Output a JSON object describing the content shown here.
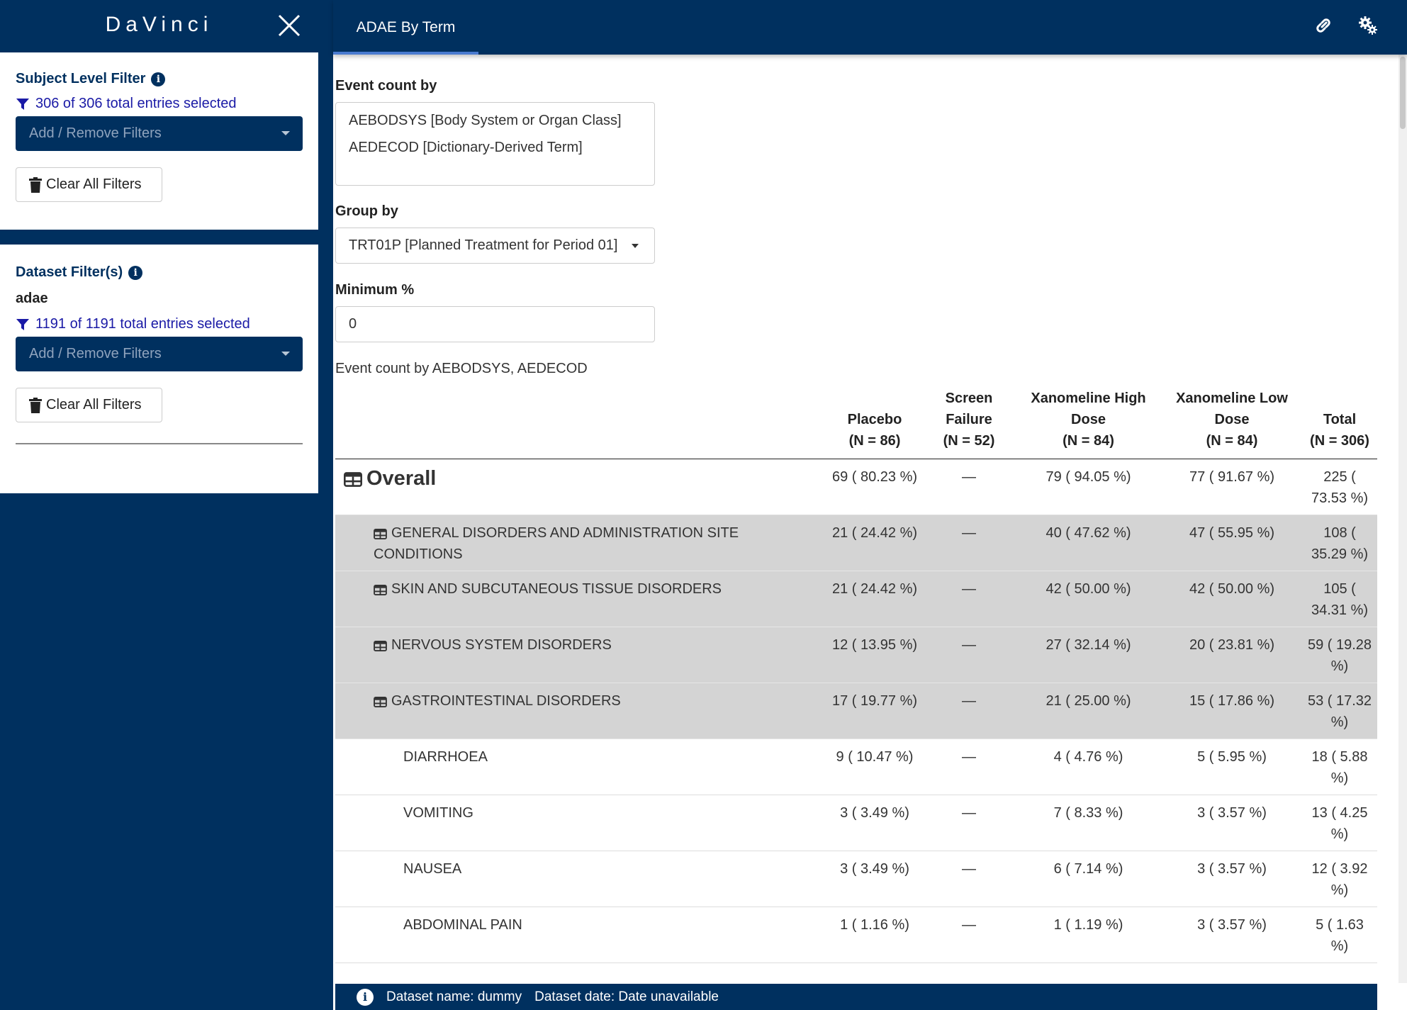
{
  "app": {
    "brand": "DaVinci"
  },
  "sidebar": {
    "subject_filter": {
      "title": "Subject Level Filter",
      "selected_text": "306 of 306 total entries selected",
      "dropdown_placeholder": "Add / Remove Filters",
      "clear_label": "Clear All Filters"
    },
    "dataset_filter": {
      "title": "Dataset Filter(s)",
      "dataset": "adae",
      "selected_text": "1191 of 1191 total entries selected",
      "dropdown_placeholder": "Add / Remove Filters",
      "clear_label": "Clear All Filters"
    }
  },
  "header": {
    "tab": "ADAE By Term"
  },
  "form": {
    "event_count_label": "Event count by",
    "event_count_options": [
      "AEBODSYS [Body System or Organ Class]",
      "AEDECOD [Dictionary-Derived Term]"
    ],
    "group_by_label": "Group by",
    "group_by_value": "TRT01P [Planned Treatment for Period 01]",
    "minimum_label": "Minimum %",
    "minimum_value": "0",
    "caption": "Event count by AEBODSYS, AEDECOD"
  },
  "table": {
    "headers": [
      {
        "name": "Placebo",
        "n": "(N = 86)"
      },
      {
        "name": "Screen Failure",
        "n": "(N = 52)"
      },
      {
        "name": "Xanomeline High Dose",
        "n": "(N = 84)"
      },
      {
        "name": "Xanomeline Low Dose",
        "n": "(N = 84)"
      },
      {
        "name": "Total",
        "n": "(N = 306)"
      }
    ],
    "rows": [
      {
        "term": "Overall",
        "cells": [
          "69 ( 80.23 %)",
          "—",
          "79 ( 94.05 %)",
          "77 ( 91.67 %)",
          "225 ( 73.53 %)"
        ]
      },
      {
        "term": "GENERAL DISORDERS AND ADMINISTRATION SITE CONDITIONS",
        "cells": [
          "21 ( 24.42 %)",
          "—",
          "40 ( 47.62 %)",
          "47 ( 55.95 %)",
          "108 ( 35.29 %)"
        ]
      },
      {
        "term": "SKIN AND SUBCUTANEOUS TISSUE DISORDERS",
        "cells": [
          "21 ( 24.42 %)",
          "—",
          "42 ( 50.00 %)",
          "42 ( 50.00 %)",
          "105 ( 34.31 %)"
        ]
      },
      {
        "term": "NERVOUS SYSTEM DISORDERS",
        "cells": [
          "12 ( 13.95 %)",
          "—",
          "27 ( 32.14 %)",
          "20 ( 23.81 %)",
          "59 ( 19.28 %)"
        ]
      },
      {
        "term": "GASTROINTESTINAL DISORDERS",
        "cells": [
          "17 ( 19.77 %)",
          "—",
          "21 ( 25.00 %)",
          "15 ( 17.86 %)",
          "53 ( 17.32 %)"
        ]
      },
      {
        "term": "DIARRHOEA",
        "cells": [
          "9 ( 10.47 %)",
          "—",
          "4 ( 4.76 %)",
          "5 ( 5.95 %)",
          "18 ( 5.88 %)"
        ]
      },
      {
        "term": "VOMITING",
        "cells": [
          "3 ( 3.49 %)",
          "—",
          "7 ( 8.33 %)",
          "3 ( 3.57 %)",
          "13 ( 4.25 %)"
        ]
      },
      {
        "term": "NAUSEA",
        "cells": [
          "3 ( 3.49 %)",
          "—",
          "6 ( 7.14 %)",
          "3 ( 3.57 %)",
          "12 ( 3.92 %)"
        ]
      },
      {
        "term": "ABDOMINAL PAIN",
        "cells": [
          "1 ( 1.16 %)",
          "—",
          "1 ( 1.19 %)",
          "3 ( 3.57 %)",
          "5 ( 1.63 %)"
        ]
      }
    ]
  },
  "footer": {
    "dataset_name": "Dataset name: dummy",
    "dataset_date": "Dataset date: Date unavailable"
  },
  "icons": {
    "close": "close-icon",
    "link": "link-icon",
    "settings": "gears-icon",
    "filter": "filter-icon",
    "trash": "trash-icon",
    "info": "info-icon",
    "table": "table-icon"
  },
  "colors": {
    "brand_navy": "#00305f",
    "row_grey": "#d4d4d4",
    "link_blue": "#1a1aa6",
    "tab_underline": "#4a7bd0"
  }
}
